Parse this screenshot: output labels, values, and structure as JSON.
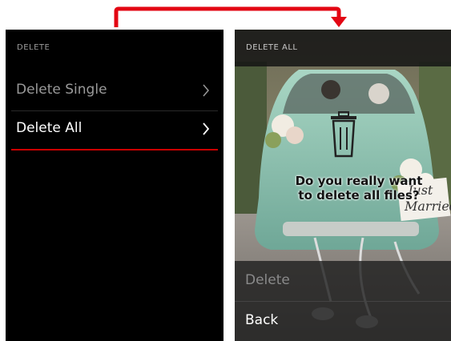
{
  "left_screen": {
    "header": "DELETE",
    "items": [
      {
        "label": "Delete Single",
        "selected": false
      },
      {
        "label": "Delete All",
        "selected": true
      }
    ]
  },
  "right_screen": {
    "header": "DELETE ALL",
    "dialog_text_line1": "Do you really want",
    "dialog_text_line2": "to delete all files?",
    "sign_text_line1": "Just",
    "sign_text_line2": "Married",
    "buttons": [
      {
        "label": "Delete",
        "enabled": false
      },
      {
        "label": "Back",
        "enabled": true
      }
    ]
  },
  "colors": {
    "accent": "#cc0000",
    "arrow": "#e30613",
    "background": "#000000"
  },
  "icons": {
    "arrow": "flow-arrow-icon",
    "chevron": "chevron-right-icon",
    "trash": "trash-icon"
  }
}
